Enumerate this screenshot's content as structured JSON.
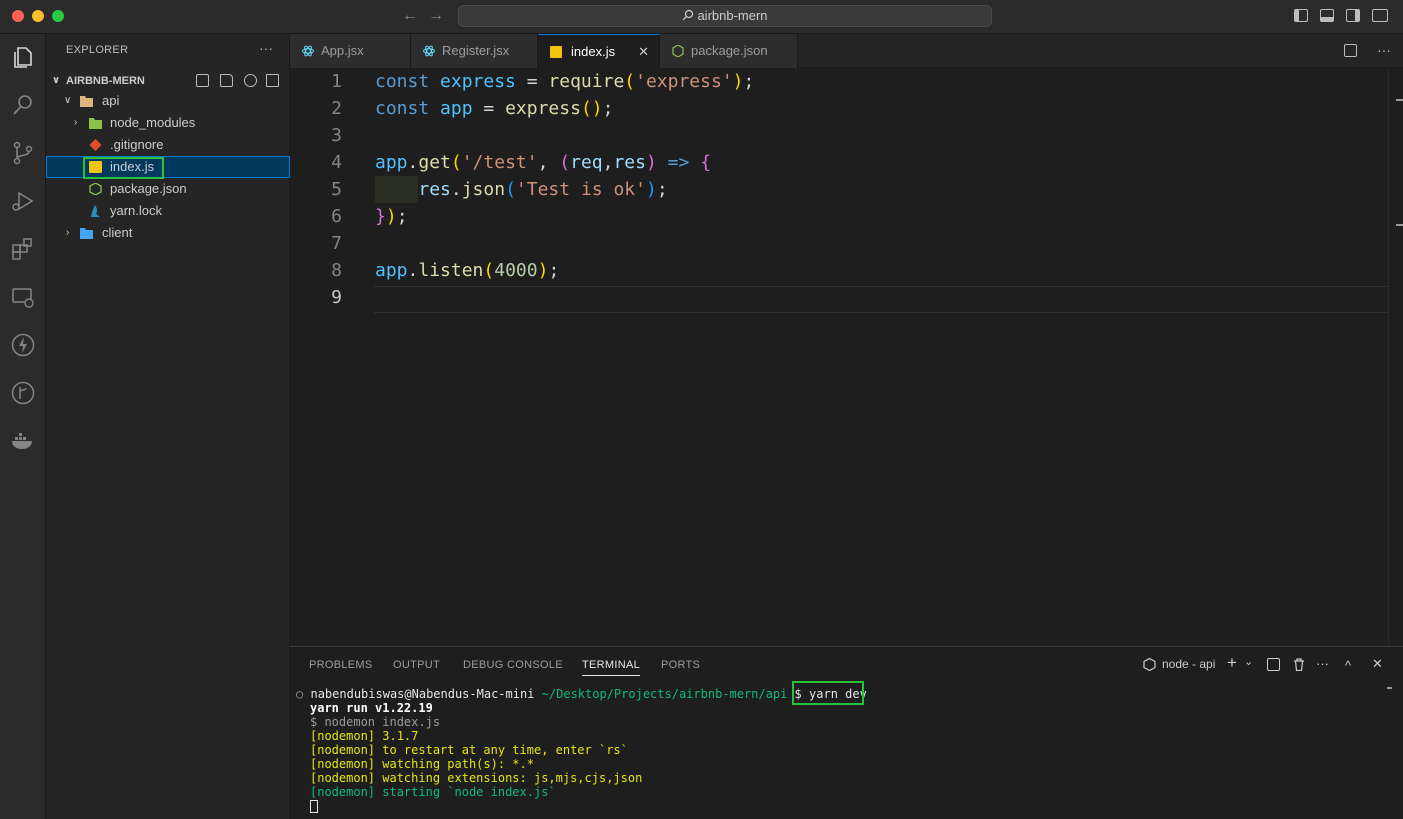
{
  "window": {
    "title": "airbnb-mern",
    "colors": {
      "close": "#ff5f57",
      "minimize": "#febc2e",
      "zoom": "#28c840",
      "accent": "#0078d4",
      "highlight": "#27c13a"
    }
  },
  "activity_bar": {
    "icons": [
      "files-icon",
      "search-icon",
      "source-control-icon",
      "run-debug-icon",
      "extensions-icon",
      "remote-explorer-icon",
      "lightning-icon",
      "git-graph-icon",
      "docker-icon"
    ]
  },
  "sidebar": {
    "title": "EXPLORER",
    "more": "···",
    "root": "AIRBNB-MERN",
    "tree": {
      "api": "api",
      "node_modules": "node_modules",
      "gitignore": ".gitignore",
      "index_js": "index.js",
      "package_json": "package.json",
      "yarn_lock": "yarn.lock",
      "client": "client"
    }
  },
  "tabs": [
    {
      "label": "App.jsx"
    },
    {
      "label": "Register.jsx"
    },
    {
      "label": "index.js"
    },
    {
      "label": "package.json"
    }
  ],
  "tab_close": "✕",
  "editor": {
    "line_numbers": [
      "1",
      "2",
      "3",
      "4",
      "5",
      "6",
      "7",
      "8",
      "9"
    ],
    "l1": {
      "a": "const",
      "b": "express",
      "c": "=",
      "d": "require",
      "e": "(",
      "f": "'express'",
      "g": ")",
      "h": ";"
    },
    "l2": {
      "a": "const",
      "b": "app",
      "c": "=",
      "d": "express",
      "e": "()",
      "f": ";"
    },
    "l4": {
      "a": "app",
      "b": ".",
      "c": "get",
      "d": "(",
      "e": "'/test'",
      "f": ",",
      "g": "(",
      "h": "req",
      "i": ",",
      "j": "res",
      "k": ")",
      "l": "=>",
      "m": "{"
    },
    "l5": {
      "a": "res",
      "b": ".",
      "c": "json",
      "d": "(",
      "e": "'Test is ok'",
      "f": ")",
      "g": ";"
    },
    "l6": {
      "a": "}",
      "b": ")",
      "c": ";"
    },
    "l8": {
      "a": "app",
      "b": ".",
      "c": "listen",
      "d": "(",
      "e": "4000",
      "f": ")",
      "g": ";"
    }
  },
  "panel": {
    "tabs": [
      "PROBLEMS",
      "OUTPUT",
      "DEBUG CONSOLE",
      "TERMINAL",
      "PORTS"
    ],
    "terminal_name": "node - api",
    "actions": {
      "add": "+",
      "dropdown": "⌄",
      "more": "···",
      "maximize": "^",
      "close": "✕"
    },
    "terminal": {
      "prompt_marker": "○",
      "prompt_user": "nabendubiswas@Nabendus-Mac-mini",
      "prompt_path": "~/Desktop/Projects/airbnb-mern/api",
      "prompt_symbol": "$",
      "command": "yarn dev",
      "lines": [
        "yarn run v1.22.19",
        "$ nodemon index.js",
        "[nodemon] 3.1.7",
        "[nodemon] to restart at any time, enter `rs`",
        "[nodemon] watching path(s): *.*",
        "[nodemon] watching extensions: js,mjs,cjs,json",
        "[nodemon] starting `node index.js`"
      ]
    }
  }
}
